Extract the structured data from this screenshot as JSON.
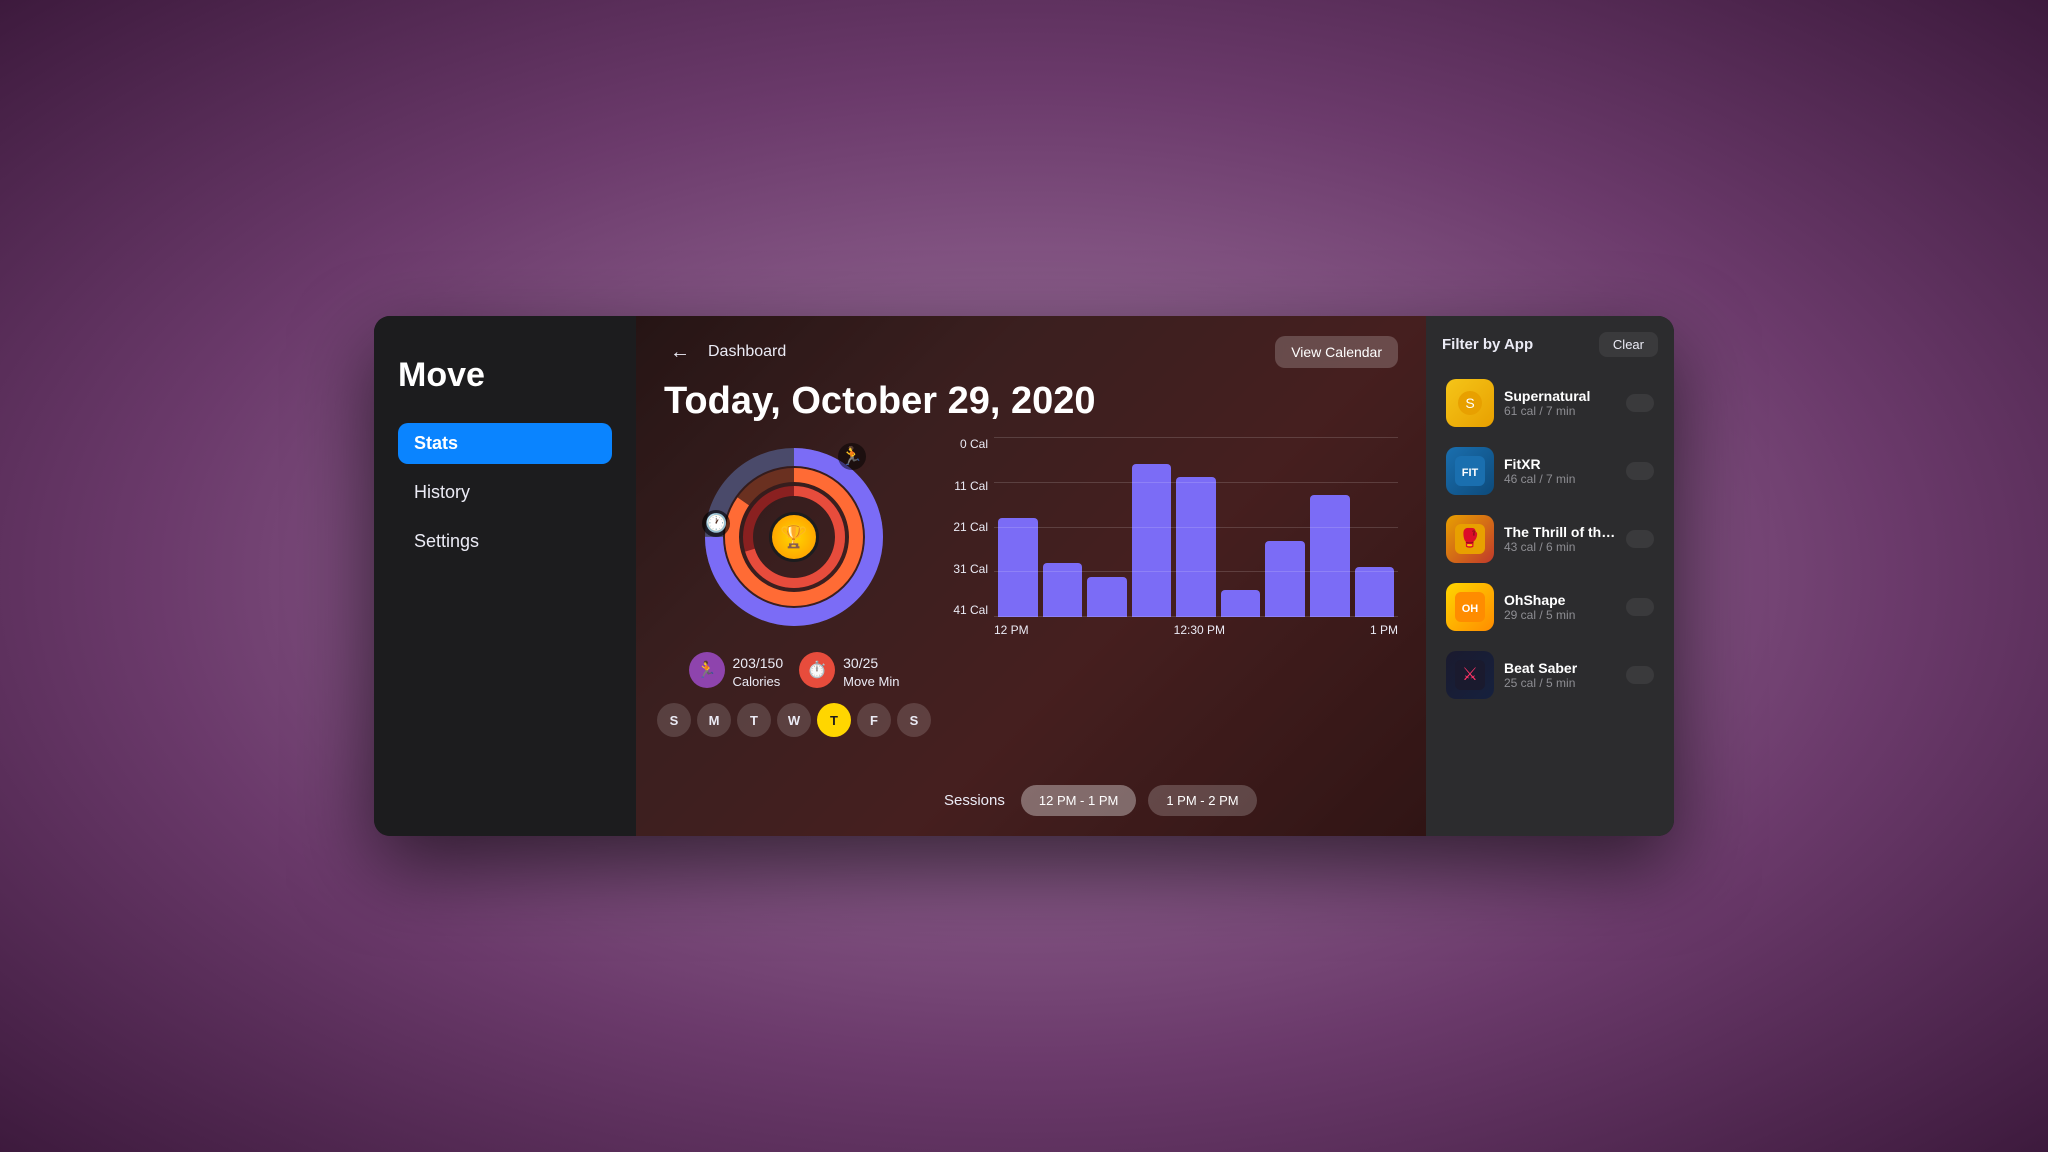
{
  "sidebar": {
    "title": "Move",
    "items": [
      {
        "id": "stats",
        "label": "Stats",
        "active": true
      },
      {
        "id": "history",
        "label": "History",
        "active": false
      },
      {
        "id": "settings",
        "label": "Settings",
        "active": false
      }
    ]
  },
  "header": {
    "back_label": "←",
    "breadcrumb": "Dashboard",
    "date_title": "Today, October 29, 2020",
    "view_calendar_label": "View Calendar"
  },
  "stats": {
    "calories_value": "203",
    "calories_goal": "/150",
    "calories_label": "Calories",
    "move_min_value": "30",
    "move_min_goal": "/25",
    "move_min_label": "Move Min"
  },
  "days": [
    {
      "label": "S",
      "active": false
    },
    {
      "label": "M",
      "active": false
    },
    {
      "label": "T",
      "active": false
    },
    {
      "label": "W",
      "active": false
    },
    {
      "label": "T",
      "active": true
    },
    {
      "label": "F",
      "active": false
    },
    {
      "label": "S",
      "active": false
    }
  ],
  "chart": {
    "y_labels": [
      "0 Cal",
      "11 Cal",
      "21 Cal",
      "31 Cal",
      "41 Cal"
    ],
    "x_labels": [
      "12 PM",
      "12:30 PM",
      "1 PM"
    ],
    "bars": [
      55,
      30,
      22,
      85,
      75,
      15,
      40,
      70,
      30
    ]
  },
  "sessions": {
    "label": "Sessions",
    "options": [
      {
        "label": "12 PM - 1 PM",
        "active": true
      },
      {
        "label": "1 PM - 2 PM",
        "active": false
      }
    ]
  },
  "filter": {
    "title": "Filter by App",
    "clear_label": "Clear",
    "apps": [
      {
        "id": "supernatural",
        "name": "Supernatural",
        "stats": "61 cal / 7 min",
        "icon": "🌟"
      },
      {
        "id": "fitxr",
        "name": "FitXR",
        "stats": "46 cal / 7 min",
        "icon": "🥊"
      },
      {
        "id": "thrill",
        "name": "The Thrill of the Fi...",
        "stats": "43 cal / 6 min",
        "icon": "🎯"
      },
      {
        "id": "ohshape",
        "name": "OhShape",
        "stats": "29 cal / 5 min",
        "icon": "💃"
      },
      {
        "id": "beatsaber",
        "name": "Beat Saber",
        "stats": "25 cal / 5 min",
        "icon": "⚔️"
      }
    ]
  }
}
